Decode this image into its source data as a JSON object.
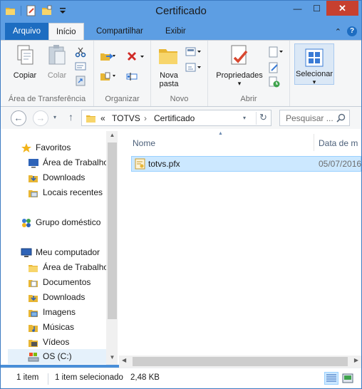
{
  "window": {
    "title": "Certificado",
    "minimize_glyph": "—",
    "maximize_glyph": "☐",
    "close_glyph": "✕"
  },
  "ribbon_tabs": {
    "arquivo": "Arquivo",
    "inicio": "Início",
    "compartilhar": "Compartilhar",
    "exibir": "Exibir",
    "collapse_glyph": "⌃",
    "help_glyph": "?"
  },
  "ribbon": {
    "copiar": "Copiar",
    "colar": "Colar",
    "group_transfer": "Área de Transferência",
    "group_organizar": "Organizar",
    "nova_pasta_line1": "Nova",
    "nova_pasta_line2": "pasta",
    "group_novo": "Novo",
    "propriedades": "Propriedades",
    "group_abrir": "Abrir",
    "selecionar": "Selecionar"
  },
  "address": {
    "back_glyph": "←",
    "forward_glyph": "→",
    "up_glyph": "↑",
    "dropdown_glyph": "▾",
    "prefix": "«",
    "crumb1": "TOTVS",
    "separator": "›",
    "crumb2": "Certificado",
    "refresh_glyph": "↻",
    "search_placeholder": "Pesquisar ..."
  },
  "nav_pane": {
    "favoritos": "Favoritos",
    "area_trabalho_fav": "Área de Trabalho",
    "downloads_fav": "Downloads",
    "locais_recentes": "Locais recentes",
    "grupo_domestico": "Grupo doméstico",
    "meu_computador": "Meu computador",
    "area_trabalho": "Área de Trabalho",
    "documentos": "Documentos",
    "downloads": "Downloads",
    "imagens": "Imagens",
    "musicas": "Músicas",
    "videos": "Vídeos",
    "os_c": "OS (C:)",
    "scroll_up": "▲",
    "scroll_down": "▼"
  },
  "content": {
    "col_name": "Nome",
    "col_date": "Data de m",
    "sort_glyph": "▲",
    "files": [
      {
        "name": "totvs.pfx",
        "date": "05/07/2016"
      }
    ],
    "scroll_left": "◀",
    "scroll_right": "▶"
  },
  "status": {
    "item_count": "1 item",
    "selected": "1 item selecionado",
    "size": "2,48 KB"
  }
}
